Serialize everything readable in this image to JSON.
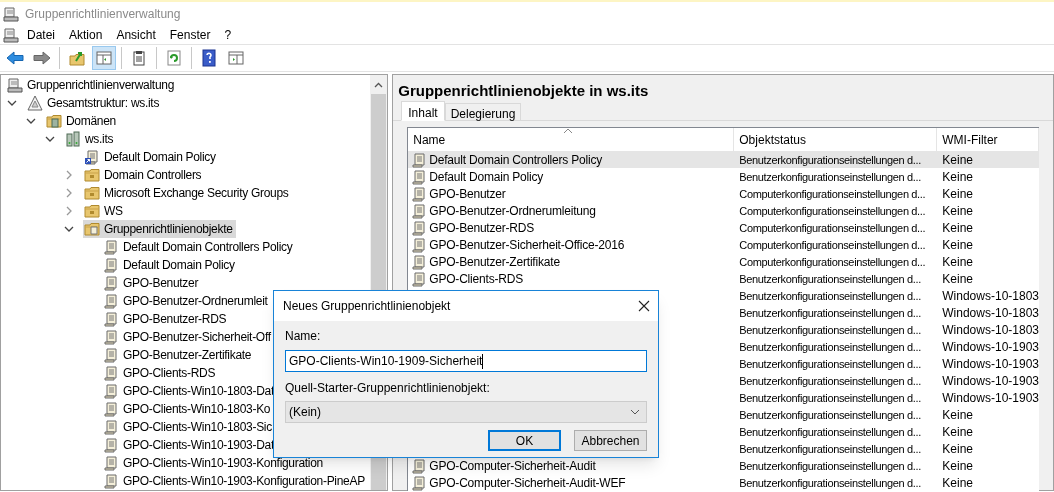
{
  "window": {
    "title": "Gruppenrichtlinienverwaltung"
  },
  "menu": [
    "Datei",
    "Aktion",
    "Ansicht",
    "Fenster",
    "?"
  ],
  "toolbar": [
    {
      "kind": "back",
      "pressed": false
    },
    {
      "kind": "forward",
      "pressed": false
    },
    {
      "kind": "separator"
    },
    {
      "kind": "up",
      "pressed": false
    },
    {
      "kind": "tree",
      "pressed": true
    },
    {
      "kind": "separator"
    },
    {
      "kind": "export",
      "pressed": false
    },
    {
      "kind": "separator"
    },
    {
      "kind": "refresh",
      "pressed": false
    },
    {
      "kind": "separator"
    },
    {
      "kind": "help",
      "pressed": false
    },
    {
      "kind": "actionpane",
      "pressed": false
    }
  ],
  "tree": [
    {
      "label": "Gruppenrichtlinienverwaltung",
      "kind": "console",
      "selected": false,
      "children": [
        {
          "label": "Gesamtstruktur: ws.its",
          "kind": "forest",
          "selected": false,
          "expanded": true,
          "children": [
            {
              "label": "Domänen",
              "kind": "domains",
              "selected": false,
              "expanded": true,
              "children": [
                {
                  "label": "ws.its",
                  "kind": "domain",
                  "selected": false,
                  "expanded": true,
                  "children": [
                    {
                      "label": "Default Domain Policy",
                      "kind": "link",
                      "selected": false
                    },
                    {
                      "label": "Domain Controllers",
                      "kind": "ou",
                      "selected": false,
                      "expanded": false
                    },
                    {
                      "label": "Microsoft Exchange Security Groups",
                      "kind": "ou",
                      "selected": false,
                      "expanded": false
                    },
                    {
                      "label": "WS",
                      "kind": "ou",
                      "selected": false,
                      "expanded": false
                    },
                    {
                      "label": "Gruppenrichtlinienobjekte",
                      "kind": "gpofolder",
                      "selected": true,
                      "expanded": true,
                      "children": [
                        {
                          "label": "Default Domain Controllers Policy",
                          "kind": "gpo",
                          "selected": false
                        },
                        {
                          "label": "Default Domain Policy",
                          "kind": "gpo",
                          "selected": false
                        },
                        {
                          "label": "GPO-Benutzer",
                          "kind": "gpo",
                          "selected": false
                        },
                        {
                          "label": "GPO-Benutzer-Ordnerumleit",
                          "kind": "gpo",
                          "selected": false
                        },
                        {
                          "label": "GPO-Benutzer-RDS",
                          "kind": "gpo",
                          "selected": false
                        },
                        {
                          "label": "GPO-Benutzer-Sicherheit-Off",
                          "kind": "gpo",
                          "selected": false
                        },
                        {
                          "label": "GPO-Benutzer-Zertifikate",
                          "kind": "gpo",
                          "selected": false
                        },
                        {
                          "label": "GPO-Clients-RDS",
                          "kind": "gpo",
                          "selected": false
                        },
                        {
                          "label": "GPO-Clients-Win10-1803-Dat",
                          "kind": "gpo",
                          "selected": false
                        },
                        {
                          "label": "GPO-Clients-Win10-1803-Ko",
                          "kind": "gpo",
                          "selected": false
                        },
                        {
                          "label": "GPO-Clients-Win10-1803-Sic",
                          "kind": "gpo",
                          "selected": false
                        },
                        {
                          "label": "GPO-Clients-Win10-1903-Dat",
                          "kind": "gpo",
                          "selected": false
                        },
                        {
                          "label": "GPO-Clients-Win10-1903-Konfiguration",
                          "kind": "gpo",
                          "selected": false
                        },
                        {
                          "label": "GPO-Clients-Win10-1903-Konfiguration-PineAP",
                          "kind": "gpo",
                          "selected": false
                        }
                      ]
                    }
                  ]
                }
              ]
            }
          ]
        }
      ]
    }
  ],
  "details": {
    "title": "Gruppenrichtlinienobjekte in ws.its",
    "tabs": [
      {
        "label": "Inhalt",
        "selected": true
      },
      {
        "label": "Delegierung",
        "selected": false
      }
    ],
    "columns": [
      "Name",
      "Objektstatus",
      "WMI-Filter"
    ],
    "rows": [
      {
        "name": "Default Domain Controllers Policy",
        "status": "Benutzerkonfigurationseinstellungen d...",
        "wmi": "Keine",
        "selected": true
      },
      {
        "name": "Default Domain Policy",
        "status": "Benutzerkonfigurationseinstellungen d...",
        "wmi": "Keine",
        "selected": false
      },
      {
        "name": "GPO-Benutzer",
        "status": "Computerkonfigurationseinstellungen d...",
        "wmi": "Keine",
        "selected": false
      },
      {
        "name": "GPO-Benutzer-Ordnerumleitung",
        "status": "Computerkonfigurationseinstellungen d...",
        "wmi": "Keine",
        "selected": false
      },
      {
        "name": "GPO-Benutzer-RDS",
        "status": "Computerkonfigurationseinstellungen d...",
        "wmi": "Keine",
        "selected": false
      },
      {
        "name": "GPO-Benutzer-Sicherheit-Office-2016",
        "status": "Computerkonfigurationseinstellungen d...",
        "wmi": "Keine",
        "selected": false
      },
      {
        "name": "GPO-Benutzer-Zertifikate",
        "status": "Computerkonfigurationseinstellungen d...",
        "wmi": "Keine",
        "selected": false
      },
      {
        "name": "GPO-Clients-RDS",
        "status": "Benutzerkonfigurationseinstellungen d...",
        "wmi": "Keine",
        "selected": false
      },
      {
        "status": "Benutzerkonfigurationseinstellungen d...",
        "wmi": "Windows-10-1803",
        "selected": false
      },
      {
        "status": "Benutzerkonfigurationseinstellungen d...",
        "wmi": "Windows-10-1803",
        "selected": false
      },
      {
        "status": "Benutzerkonfigurationseinstellungen d...",
        "wmi": "Windows-10-1803",
        "selected": false
      },
      {
        "status": "Benutzerkonfigurationseinstellungen d...",
        "wmi": "Windows-10-1903",
        "selected": false
      },
      {
        "status": "Benutzerkonfigurationseinstellungen d...",
        "wmi": "Windows-10-1903",
        "selected": false
      },
      {
        "status": "Benutzerkonfigurationseinstellungen d...",
        "wmi": "Windows-10-1903",
        "selected": false
      },
      {
        "status": "Benutzerkonfigurationseinstellungen d...",
        "wmi": "Windows-10-1903",
        "selected": false
      },
      {
        "status": "Benutzerkonfigurationseinstellungen d...",
        "wmi": "Keine",
        "selected": false
      },
      {
        "status": "Benutzerkonfigurationseinstellungen d...",
        "wmi": "Keine",
        "selected": false
      },
      {
        "status": "Benutzerkonfigurationseinstellungen d...",
        "wmi": "Keine",
        "selected": false
      },
      {
        "name": "GPO-Computer-Sicherheit-Audit",
        "status": "Benutzerkonfigurationseinstellungen d...",
        "wmi": "Keine",
        "selected": false
      },
      {
        "name": "GPO-Computer-Sicherheit-Audit-WEF",
        "status": "Benutzerkonfigurationseinstellungen d...",
        "wmi": "Keine",
        "selected": false
      }
    ]
  },
  "dialog": {
    "title": "Neues Gruppenrichtlinienobjekt",
    "name_label": "Name:",
    "name_value": "GPO-Clients-Win10-1909-Sicherheit",
    "source_label": "Quell-Starter-Gruppenrichtlinienobjekt:",
    "source_value": "(Kein)",
    "buttons": [
      {
        "label": "OK",
        "default": true
      },
      {
        "label": "Abbrechen",
        "default": false
      }
    ]
  }
}
